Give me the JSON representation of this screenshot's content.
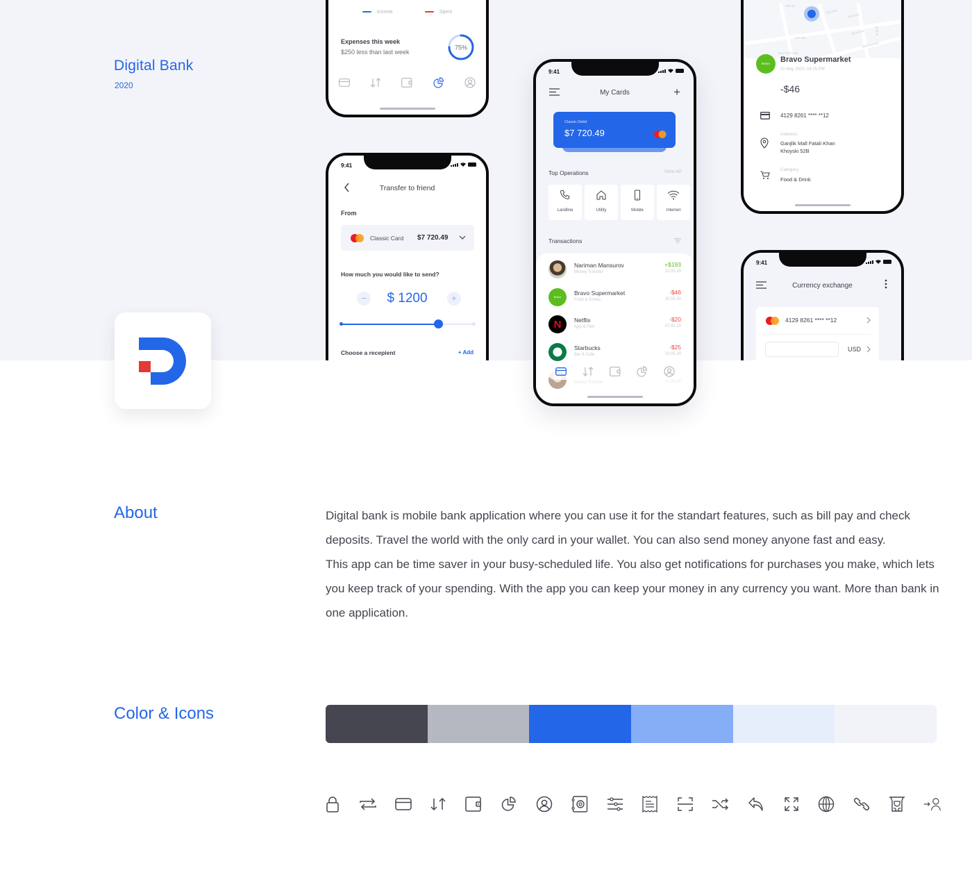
{
  "brand": {
    "title": "Digital Bank",
    "year": "2020"
  },
  "colors": {
    "primary": "#2466e8",
    "accent_red": "#e53935",
    "text_dark": "#44454f",
    "income_green": "#58c322",
    "expense_red": "#f2453d"
  },
  "phone_stats": {
    "legend": [
      {
        "label": "Income",
        "color": "#2466e8"
      },
      {
        "label": "Spent",
        "color": "#e53935"
      }
    ],
    "expenses_title": "Expenses this week",
    "expenses_sub": "$250 less than last week",
    "progress_label": "75%",
    "progress_value": 0.75,
    "nav_active": "stats"
  },
  "phone_transfer": {
    "time": "9:41",
    "title": "Transfer to friend",
    "from_label": "From",
    "card_name": "Classic Card",
    "card_balance": "$7 720.49",
    "question": "How much you would like to send?",
    "minus": "−",
    "plus": "+",
    "amount": "$ 1200",
    "slider_value": 0.73,
    "recipient_label": "Choose a recepient",
    "add_label": "+ Add"
  },
  "phone_cards": {
    "time": "9:41",
    "title": "My Cards",
    "card_label": "Classic Debit",
    "card_balance": "$7 720.49",
    "top_ops_title": "Top Operations",
    "view_all": "View All",
    "operations": [
      {
        "label": "Landline",
        "icon": "phone-icon"
      },
      {
        "label": "Utility",
        "icon": "home-icon"
      },
      {
        "label": "Mobile",
        "icon": "mobile-icon"
      },
      {
        "label": "Internet",
        "icon": "wifi-icon"
      }
    ],
    "transactions_title": "Transactions",
    "transactions": [
      {
        "name": "Nariman Mansurov",
        "sub": "Money Transfer",
        "amount": "+$193",
        "date": "12.05.20",
        "type": "income",
        "avatar": "person"
      },
      {
        "name": "Bravo Supermarket",
        "sub": "Food & Drinks",
        "amount": "-$46",
        "date": "10.05.20",
        "type": "expense",
        "avatar": "bravo"
      },
      {
        "name": "Netflix",
        "sub": "App & Film",
        "amount": "-$20",
        "date": "07.05.20",
        "type": "expense",
        "avatar": "netflix"
      },
      {
        "name": "Starbucks",
        "sub": "Bar & Cafe",
        "amount": "-$25",
        "date": "10.05.20",
        "type": "expense",
        "avatar": "starbucks"
      },
      {
        "name": "",
        "sub": "Money Transfer",
        "amount": "",
        "date": "07.05.20",
        "type": "income",
        "avatar": "person2"
      }
    ],
    "nav_active": "cards"
  },
  "phone_detail": {
    "map_labels": [
      "40th Dr",
      "41st Ave",
      "41st Ave",
      "41st Rd",
      "42nd Ave",
      "97th Pl",
      "43rd Avenue",
      "New York City"
    ],
    "merchant": "Bravo Supermarket",
    "merchant_logo": "Bravo",
    "datetime": "10 May 2020, 04:25 PM",
    "amount": "-$46",
    "card_number": "4129 8261 **** **12",
    "address_label": "Address",
    "address_line1": "Ganjlik Mall Fatali Khan",
    "address_line2": "Khoyski 52B",
    "category_label": "Category",
    "category": "Food & Drink"
  },
  "phone_exchange": {
    "time": "9:41",
    "title": "Currency exchange",
    "card_number": "4129 8261 **** **12",
    "amount_input": "",
    "currency": "USD"
  },
  "about": {
    "title": "About",
    "paragraph1": "Digital bank is mobile bank application where you can use it for the standart features, such as bill pay and check deposits. Travel the world with the only card in your wallet. You can also send money anyone fast and easy.",
    "paragraph2": "This app can be time saver in your busy-scheduled life. You also get notifications for purchases you make, which lets you keep track of your spending. With the app you can keep your money in any currency you want. More than bank in one application."
  },
  "color_icons": {
    "title": "Color & Icons",
    "palette": [
      "#454650",
      "#b5b8c1",
      "#2466e8",
      "#85aef7",
      "#e7eefb",
      "#f2f3f8"
    ],
    "icons": [
      "lock-icon",
      "transfer-icon",
      "card-icon",
      "sort-arrows-icon",
      "wallet-icon",
      "pie-chart-icon",
      "user-circle-icon",
      "safe-icon",
      "sliders-icon",
      "receipt-icon",
      "scan-icon",
      "shuffle-icon",
      "reply-icon",
      "expand-icon",
      "globe-icon",
      "link-icon",
      "atm-icon",
      "send-to-user-icon"
    ]
  }
}
